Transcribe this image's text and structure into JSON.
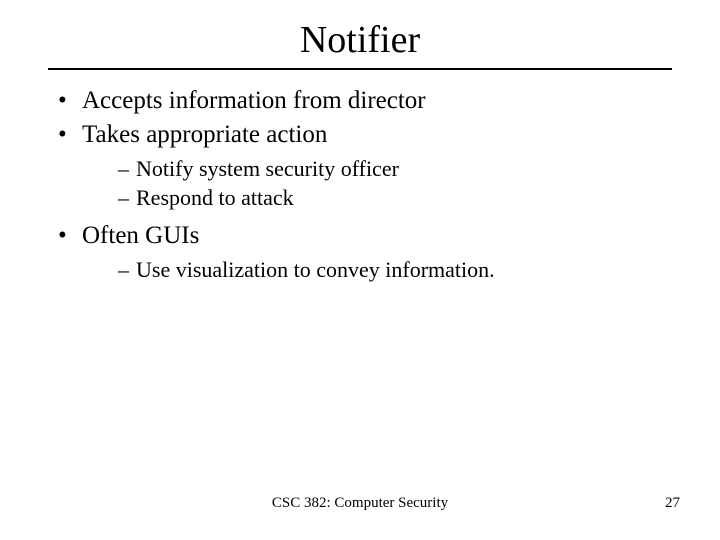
{
  "title": "Notifier",
  "bullets": {
    "item1": "Accepts information from director",
    "item2": "Takes appropriate action",
    "item2_sub1": "Notify system security officer",
    "item2_sub2": "Respond to attack",
    "item3": "Often GUIs",
    "item3_sub1": "Use visualization to convey information."
  },
  "footer": {
    "course": "CSC 382: Computer Security",
    "page": "27"
  }
}
